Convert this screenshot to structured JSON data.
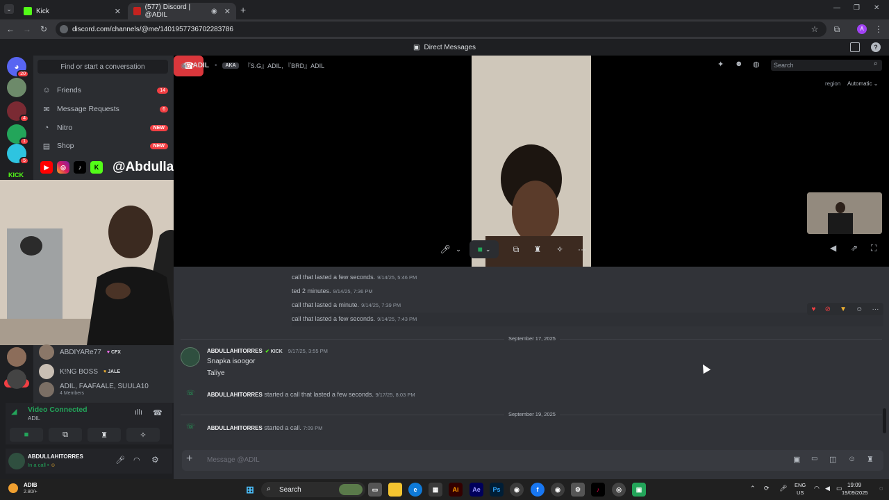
{
  "browser": {
    "tabs": [
      {
        "title": "Kick",
        "favicon_color": "#53fc18"
      },
      {
        "title": "(577) Discord | @ADIL",
        "favicon_color": "#c5221f"
      }
    ],
    "url": "discord.com/channels/@me/1401957736702283786"
  },
  "discord": {
    "top_title": "Direct Messages",
    "servers": [
      {
        "badge": "20",
        "color": "#5865f2"
      },
      {
        "badge": "",
        "color": "#6d8a6a"
      },
      {
        "badge": "4",
        "color": "#7a2a33"
      },
      {
        "badge": "1",
        "color": "#23a55a"
      },
      {
        "badge": "5",
        "color": "#2ec4e0"
      }
    ],
    "rail_label": "KICK",
    "find_placeholder": "Find or start a conversation",
    "nav": [
      {
        "label": "Friends",
        "badge": "14",
        "icon": "friends-icon"
      },
      {
        "label": "Message Requests",
        "badge": "6",
        "icon": "mail-icon"
      },
      {
        "label": "Nitro",
        "badge": "NEW",
        "icon": "nitro-icon"
      },
      {
        "label": "Shop",
        "badge": "NEW",
        "icon": "shop-icon"
      }
    ],
    "dms": [
      {
        "name": "ABDIYARe77",
        "tag": "CFX"
      },
      {
        "name": "K!NG BOSS",
        "tag": "JALE"
      },
      {
        "name": "ADIL, FAAFAALE, SUULA10",
        "sub": "4 Members"
      }
    ],
    "new_label": "NEW",
    "voice": {
      "status": "Video Connected",
      "channel": "ADIL"
    },
    "user": {
      "name": "ABDULLAHITORRES",
      "status": "In a call •"
    },
    "call": {
      "name": "ADIL",
      "aka_label": "AKA",
      "aliases": "『S.G』ADIL, 『BRD』ADIL",
      "search_placeholder": "Search",
      "region_label": "region",
      "region_value": "Automatic"
    },
    "history": [
      {
        "text": "call that lasted a few seconds.",
        "ts": "9/14/25, 5:46 PM"
      },
      {
        "text": "ted 2 minutes.",
        "ts": "9/14/25, 7:36 PM"
      },
      {
        "text": "call that lasted a minute.",
        "ts": "9/14/25, 7:39 PM"
      },
      {
        "text": "call that lasted a few seconds.",
        "ts": "9/14/25, 7:43 PM"
      }
    ],
    "date1": "September 17, 2025",
    "message": {
      "author": "ABDULLAHITORRES",
      "badge": "KICK",
      "ts": "9/17/25, 3:55 PM",
      "lines": [
        "Snapka isoogor",
        "Taliye"
      ]
    },
    "call_log1": {
      "author": "ABDULLAHITORRES",
      "text": "started a call that lasted a few seconds.",
      "ts": "9/17/25, 8:03 PM"
    },
    "date2": "September 19, 2025",
    "call_log2": {
      "author": "ABDULLAHITORRES",
      "text": "started a call.",
      "ts": "7:09 PM"
    },
    "composer_placeholder": "Message @ADIL"
  },
  "overlay": {
    "handle": "@Abdullahitorres"
  },
  "taskbar": {
    "weather_title": "ADIB",
    "weather_sub": "2.80/+",
    "search_label": "Search",
    "lang": "ENG",
    "region": "US",
    "time": "19:09",
    "date": "19/09/2025"
  }
}
